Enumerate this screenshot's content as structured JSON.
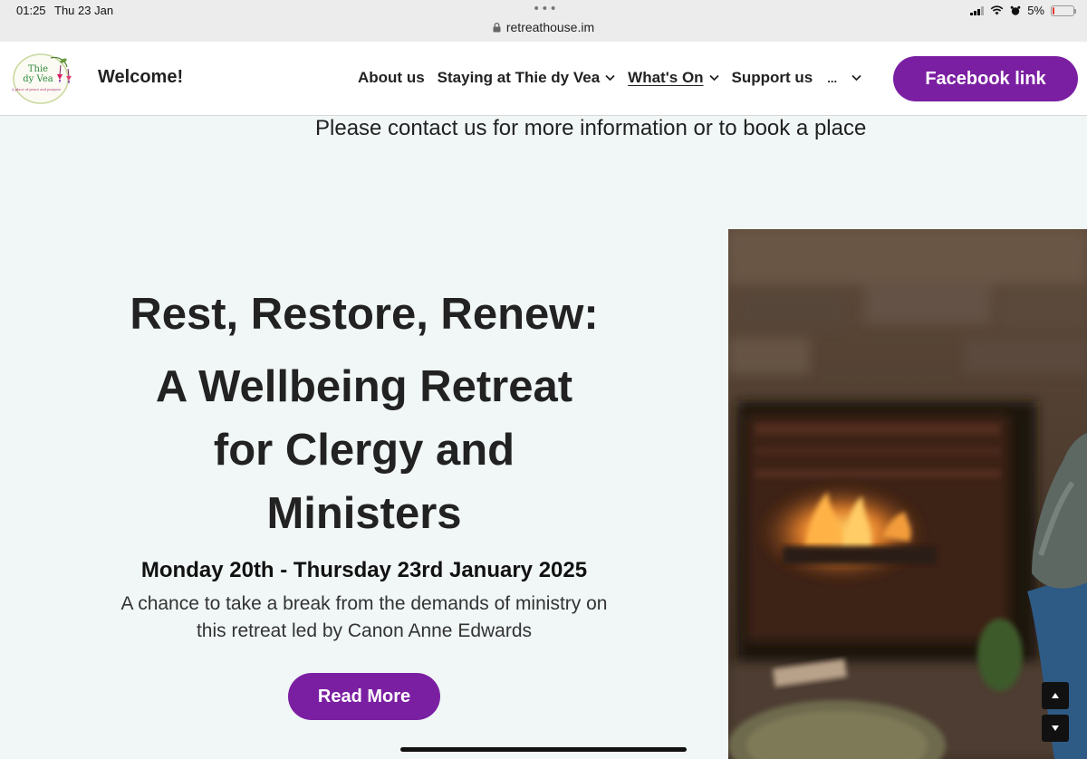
{
  "status_bar": {
    "time": "01:25",
    "date": "Thu 23 Jan",
    "url": "retreathouse.im",
    "battery": "5%",
    "battery_level": 0.05
  },
  "header": {
    "site_title": "Welcome!",
    "nav": [
      {
        "label": "About us",
        "has_dropdown": false
      },
      {
        "label": "Staying at Thie dy Vea",
        "has_dropdown": true
      },
      {
        "label": "What's On",
        "has_dropdown": true,
        "active": true
      },
      {
        "label": "Support us",
        "has_dropdown": false
      },
      {
        "label": "...",
        "has_dropdown": true
      }
    ],
    "cta_label": "Facebook link"
  },
  "logo": {
    "line1": "Thie",
    "line2": "dy Vea",
    "tagline": "A place of peace and purpose"
  },
  "main": {
    "contact_line": "Please contact us for more information or to book a place",
    "title_line1": "Rest, Restore, Renew:",
    "title_line2": "A Wellbeing Retreat for Clergy and Ministers",
    "date": "Monday 20th - Thursday 23rd January 2025",
    "description": "A chance to take a break from the demands of ministry on this retreat led by Canon Anne Edwards",
    "read_more_label": "Read More"
  },
  "colors": {
    "accent": "#7b1fa2",
    "background": "#f0f7f6"
  }
}
